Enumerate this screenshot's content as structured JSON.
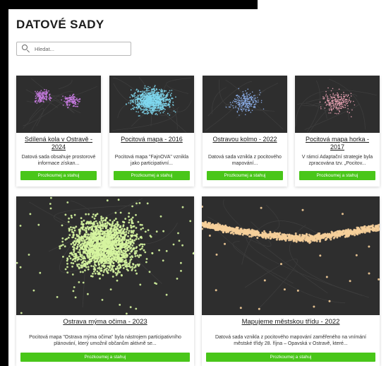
{
  "page": {
    "title": "DATOVÉ SADY"
  },
  "search": {
    "placeholder": "Hledat..."
  },
  "datasets": [
    {
      "title": "Sdílená kola v Ostravě - 2024",
      "description": "Datová sada obsahuje prostorové informace získan...",
      "button": "Prozkoumej a stahuj",
      "point_color": "#c77be0"
    },
    {
      "title": "Pocitová mapa - 2016",
      "description": "Pocitová mapa \"FajnOVA\" vznikla jako participativní...",
      "button": "Prozkoumej a stahuj",
      "point_color": "#7fd8f0"
    },
    {
      "title": "Ostravou kolmo - 2022",
      "description": "Datová sada vznikla z pocitového mapování...",
      "button": "Prozkoumej a stahuj",
      "point_color": "#8fb4f2"
    },
    {
      "title": "Pocitová mapa horka - 2017",
      "description": "V rámci Adaptační strategie byla zpracována tzv. „Pocitov...",
      "button": "Prozkoumej a stahuj",
      "point_color": "#f0a6b8"
    },
    {
      "title": "Ostrava mýma očima - 2023",
      "description": "Pocitová mapa \"Ostrava mýma očima\" byla nástrojem participativního plánování, který umožnil občanům aktivně se...",
      "button": "Prozkoumej a stahuj",
      "point_color": "#d6f5a0"
    },
    {
      "title": "Mapujeme městskou třídu - 2022",
      "description": "Datová sada vznikla z pocitového mapování zaměřeného na vnímání městské třídy 28. října – Opavská v Ostravě, které...",
      "button": "Prozkoumej a stahuj",
      "point_color": "#f6cf9a"
    }
  ]
}
